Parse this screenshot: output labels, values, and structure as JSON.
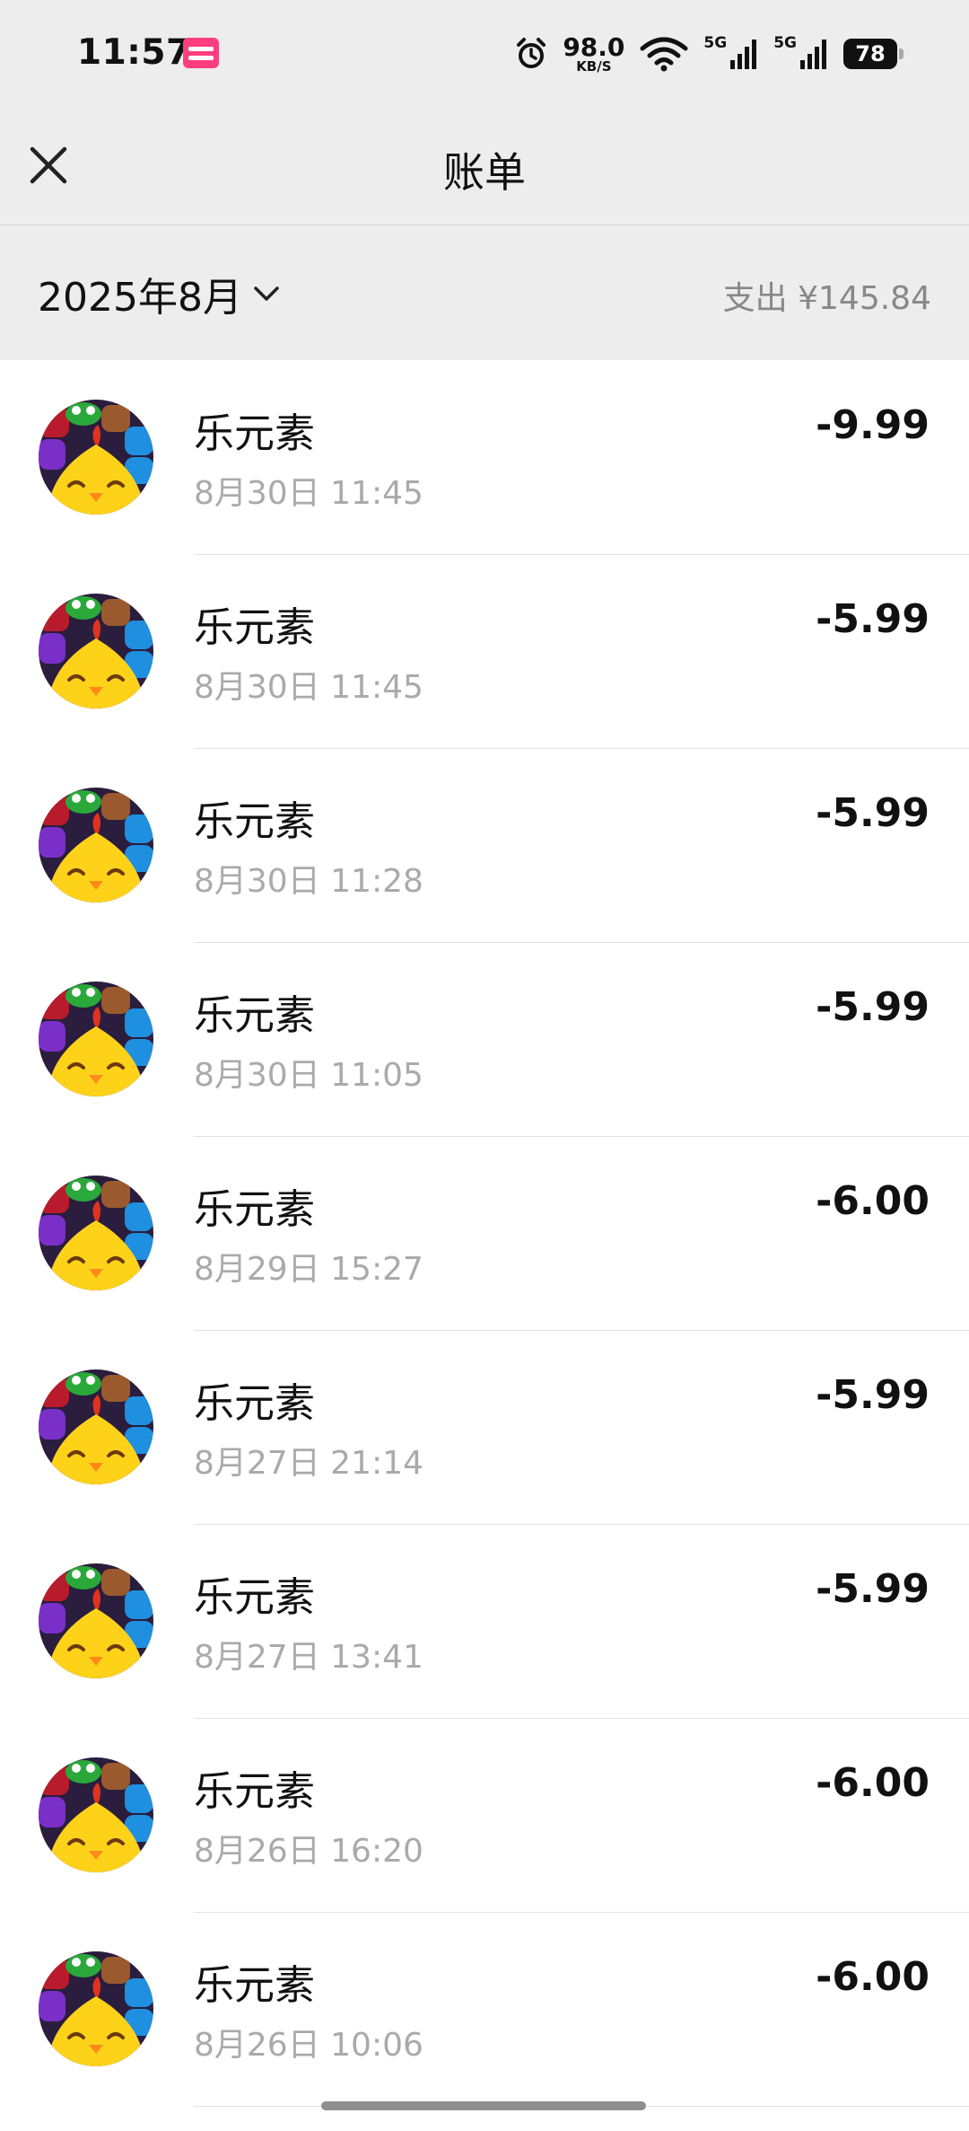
{
  "status_bar": {
    "time": "11:57",
    "app_icon": "shopping-app-icon",
    "network_speed": "98.0",
    "network_speed_unit": "KB/S",
    "network_type_1": "5G",
    "network_type_2": "5G",
    "battery_level": "78"
  },
  "nav": {
    "title": "账单",
    "close_icon": "close-icon"
  },
  "summary": {
    "month": "2025年8月",
    "total": "支出 ¥145.84"
  },
  "transactions": [
    {
      "name": "乐元素",
      "time": "8月30日 11:45",
      "amount": "-9.99"
    },
    {
      "name": "乐元素",
      "time": "8月30日 11:45",
      "amount": "-5.99"
    },
    {
      "name": "乐元素",
      "time": "8月30日 11:28",
      "amount": "-5.99"
    },
    {
      "name": "乐元素",
      "time": "8月30日 11:05",
      "amount": "-5.99"
    },
    {
      "name": "乐元素",
      "time": "8月29日 15:27",
      "amount": "-6.00"
    },
    {
      "name": "乐元素",
      "time": "8月27日 21:14",
      "amount": "-5.99"
    },
    {
      "name": "乐元素",
      "time": "8月27日 13:41",
      "amount": "-5.99"
    },
    {
      "name": "乐元素",
      "time": "8月26日 16:20",
      "amount": "-6.00"
    },
    {
      "name": "乐元素",
      "time": "8月26日 10:06",
      "amount": "-6.00"
    }
  ]
}
